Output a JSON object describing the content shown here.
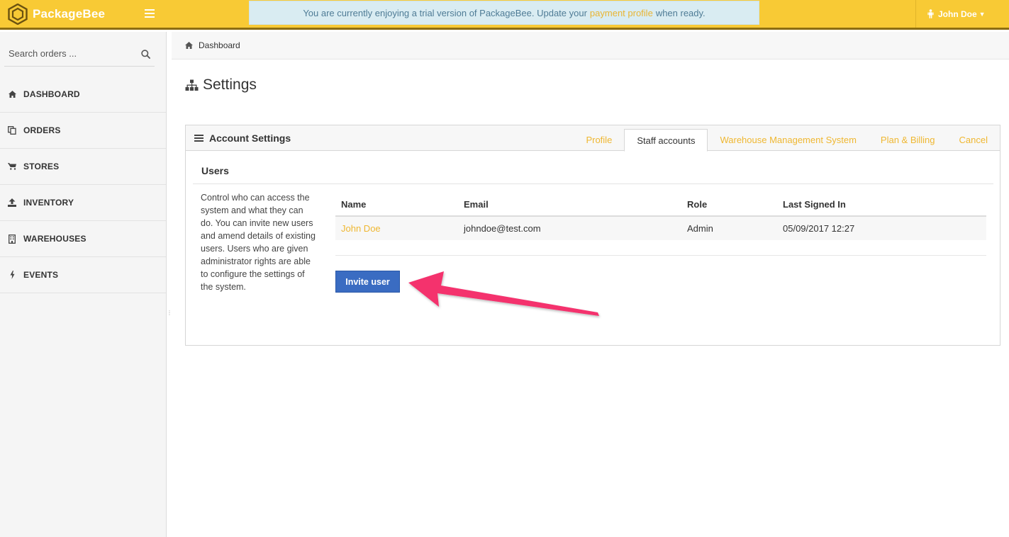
{
  "app": {
    "name": "PackageBee"
  },
  "banner": {
    "text_before": "You are currently enjoying a trial version of PackageBee. Update your",
    "link_text": "payment profile",
    "text_after": "when ready."
  },
  "user_menu": {
    "name": "John Doe"
  },
  "sidebar": {
    "search_placeholder": "Search orders ...",
    "items": [
      {
        "label": "DASHBOARD",
        "icon": "home-icon"
      },
      {
        "label": "ORDERS",
        "icon": "copy-icon"
      },
      {
        "label": "STORES",
        "icon": "cart-icon"
      },
      {
        "label": "INVENTORY",
        "icon": "upload-icon"
      },
      {
        "label": "WAREHOUSES",
        "icon": "building-icon"
      },
      {
        "label": "EVENTS",
        "icon": "bolt-icon"
      }
    ]
  },
  "breadcrumb": {
    "label": "Dashboard"
  },
  "page": {
    "title": "Settings"
  },
  "panel": {
    "title": "Account Settings",
    "tabs": [
      {
        "label": "Profile",
        "active": false
      },
      {
        "label": "Staff accounts",
        "active": true
      },
      {
        "label": "Warehouse Management System",
        "active": false
      },
      {
        "label": "Plan & Billing",
        "active": false
      },
      {
        "label": "Cancel",
        "active": false
      }
    ],
    "section_title": "Users",
    "description": "Control who can access the system and what they can do. You can invite new users and amend details of existing users. Users who are given administrator rights are able to configure the settings of the system.",
    "table": {
      "headers": {
        "name": "Name",
        "email": "Email",
        "role": "Role",
        "last_signed_in": "Last Signed In"
      },
      "rows": [
        {
          "name": "John Doe",
          "email": "johndoe@test.com",
          "role": "Admin",
          "last_signed_in": "05/09/2017 12:27"
        }
      ]
    },
    "invite_button": "Invite user"
  },
  "colors": {
    "topbar": "#f8ca35",
    "link": "#efb731",
    "button": "#3a6cc2",
    "annotation_arrow": "#f4306d"
  }
}
